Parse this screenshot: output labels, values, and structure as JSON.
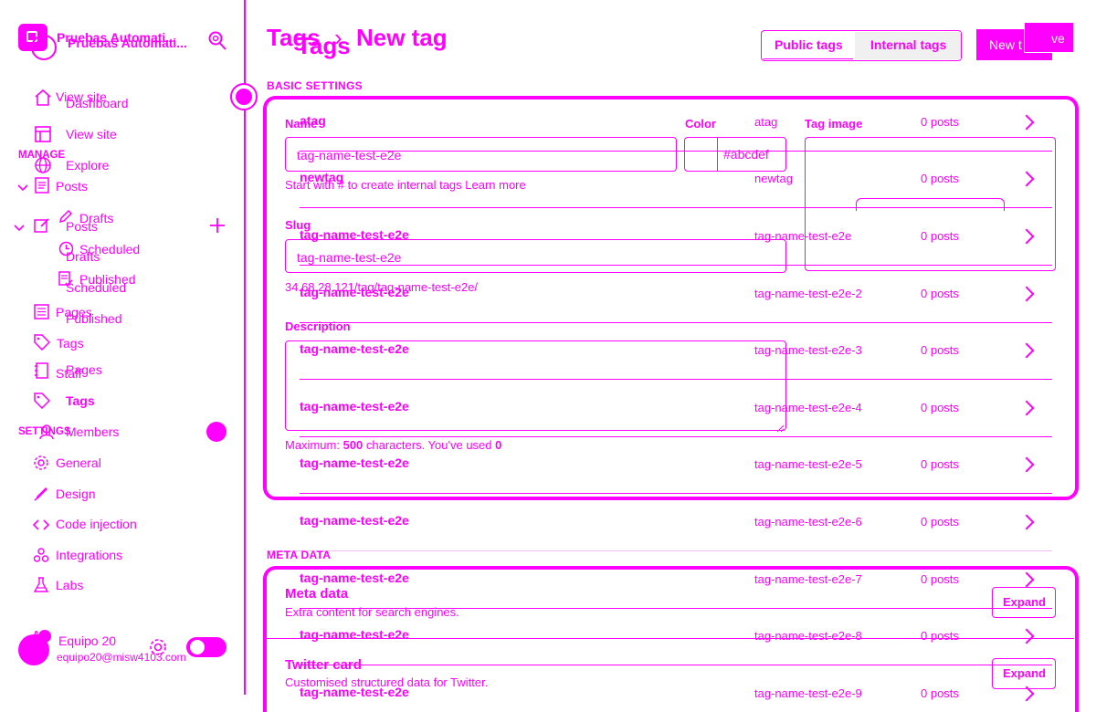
{
  "site": {
    "title_a": "Pruebas Automati...",
    "title_b": "Pruebas Automati..."
  },
  "sidebar": {
    "view_site_a": "View site",
    "dashboard": "Dashboard",
    "view_site_b": "View site",
    "manage_a": "MANAGE",
    "explore": "Explore",
    "posts_a": "Posts",
    "drafts_a": "Drafts",
    "posts_b": "Posts",
    "scheduled_a": "Scheduled",
    "drafts_b": "Drafts",
    "published_a": "Published",
    "scheduled_b": "Scheduled",
    "pages_a": "Pages",
    "published_b": "Published",
    "tags_a": "Tags",
    "staff": "Staff",
    "pages_b": "Pages",
    "tags_b": "Tags",
    "settings_a": "SETTINGS",
    "members": "Members",
    "general": "General",
    "design": "Design",
    "code_injection": "Code injection",
    "integrations": "Integrations",
    "labs": "Labs",
    "user_name": "Equipo 20",
    "user_email": "equipo20@misw4103.com",
    "mini_label": "A"
  },
  "header": {
    "tags_a": "Tags",
    "tags_b": "Tags",
    "separator": "›",
    "new_tag": "New tag",
    "public_tags": "Public tags",
    "internal_tags": "Internal tags",
    "new_tag_btn": "New t",
    "save_btn": "ve"
  },
  "form": {
    "basic_settings": "BASIC SETTINGS",
    "name_label": "Name",
    "color_label": "Color",
    "tag_image_label": "Tag image",
    "name_value": "tag-name-test-e2e",
    "color_value": "#abcdef",
    "name_hint": "Start with # to create internal tags Learn more",
    "slug_label": "Slug",
    "slug_value": "tag-name-test-e2e",
    "url_preview": "34.68.28.121/tag/tag-name-test-e2e/",
    "description_label": "Description",
    "max_hint_prefix": "Maximum: ",
    "max_hint_num": "500",
    "max_hint_mid": " characters. You've used ",
    "max_hint_used": "0",
    "meta_data_section": "META DATA",
    "meta_title": "Meta data",
    "meta_desc": "Extra content for search engines.",
    "twitter_title": "Twitter card",
    "twitter_desc": "Customised structured data for Twitter.",
    "expand": "Expand"
  },
  "tags_list": [
    {
      "name": "atag",
      "slug": "atag",
      "posts": "0 posts"
    },
    {
      "name": "newtag",
      "slug": "newtag",
      "posts": "0 posts"
    },
    {
      "name": "tag-name-test-e2e",
      "slug": "tag-name-test-e2e",
      "posts": "0 posts"
    },
    {
      "name": "tag-name-test-e2e",
      "slug": "tag-name-test-e2e-2",
      "posts": "0 posts"
    },
    {
      "name": "tag-name-test-e2e",
      "slug": "tag-name-test-e2e-3",
      "posts": "0 posts"
    },
    {
      "name": "tag-name-test-e2e",
      "slug": "tag-name-test-e2e-4",
      "posts": "0 posts"
    },
    {
      "name": "tag-name-test-e2e",
      "slug": "tag-name-test-e2e-5",
      "posts": "0 posts"
    },
    {
      "name": "tag-name-test-e2e",
      "slug": "tag-name-test-e2e-6",
      "posts": "0 posts"
    },
    {
      "name": "tag-name-test-e2e",
      "slug": "tag-name-test-e2e-7",
      "posts": "0 posts"
    },
    {
      "name": "tag-name-test-e2e",
      "slug": "tag-name-test-e2e-8",
      "posts": "0 posts"
    },
    {
      "name": "tag-name-test-e2e",
      "slug": "tag-name-test-e2e-9",
      "posts": "0 posts"
    }
  ],
  "colors": {
    "accent": "#ff00ff",
    "background": "#ffffff"
  }
}
